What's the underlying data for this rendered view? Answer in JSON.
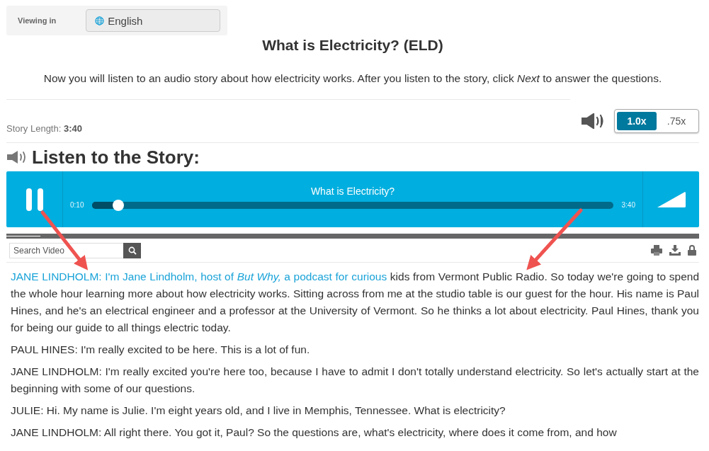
{
  "language": {
    "label": "Viewing in",
    "value": "English"
  },
  "title": "What is Electricity? (ELD)",
  "instructions": "Now you will listen to an audio story about how electricity works. After you listen to the story, click *Next* to answer the questions.",
  "story_length": {
    "label": "Story Length:",
    "value": "3:40"
  },
  "speeds": [
    {
      "label": "1.0x",
      "selected": true
    },
    {
      "label": ".75x",
      "selected": false
    }
  ],
  "heading": "Listen to the Story:",
  "player": {
    "title": "What is Electricity?",
    "elapsed": "0:10",
    "duration": "3:40",
    "playing": true,
    "level": 0.05
  },
  "search": {
    "placeholder": "Search Video"
  },
  "transcript": [
    {
      "highlighted": "JANE LINDHOLM: I'm Jane Lindholm, host of *But Why,* a podcast for curious",
      "text": "kids from Vermont Public Radio. So today we're going to spend the whole hour learning more about how electricity works. Sitting across from me at the studio table is our guest for the hour. His name is Paul Hines, and he's an electrical engineer and a professor at the University of Vermont. So he thinks a lot about electricity. Paul Hines, thank you for being our guide to all things electric today."
    },
    {
      "text": "PAUL HINES: I'm really excited to be here. This is a lot of fun."
    },
    {
      "text": "JANE LINDHOLM: I'm really excited you're here too, because I have to admit I don't totally understand electricity. So let's actually start at the beginning with some of our questions."
    },
    {
      "text": "JULIE: Hi. My name is Julie. I'm eight years old, and I live in Memphis, Tennessee. What is electricity?"
    },
    {
      "text": "JANE LINDHOLM: All right there. You got it, Paul? So the questions are, what's electricity, where does it come from, and how"
    }
  ]
}
